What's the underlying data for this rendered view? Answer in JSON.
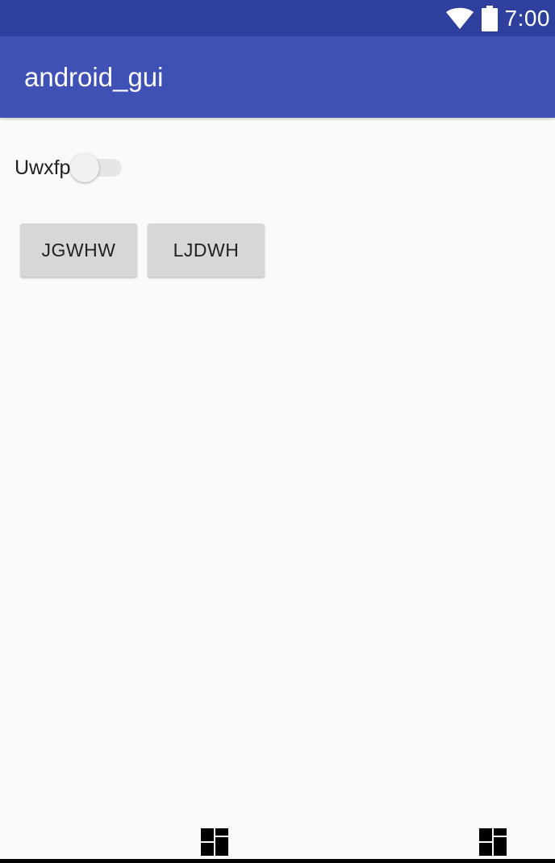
{
  "status_bar": {
    "time": "7:00",
    "icons": [
      "wifi-icon",
      "battery-icon"
    ],
    "background": "#2f3f9e"
  },
  "app_bar": {
    "title": "android_gui",
    "background": "#3f51b5"
  },
  "content": {
    "switch": {
      "label": "Uwxfp",
      "checked": false
    },
    "buttons": [
      {
        "label": "JGWHW"
      },
      {
        "label": "LJDWH"
      }
    ]
  },
  "navigation": {
    "icons": [
      "dashboard-icon",
      "dashboard-icon"
    ]
  }
}
